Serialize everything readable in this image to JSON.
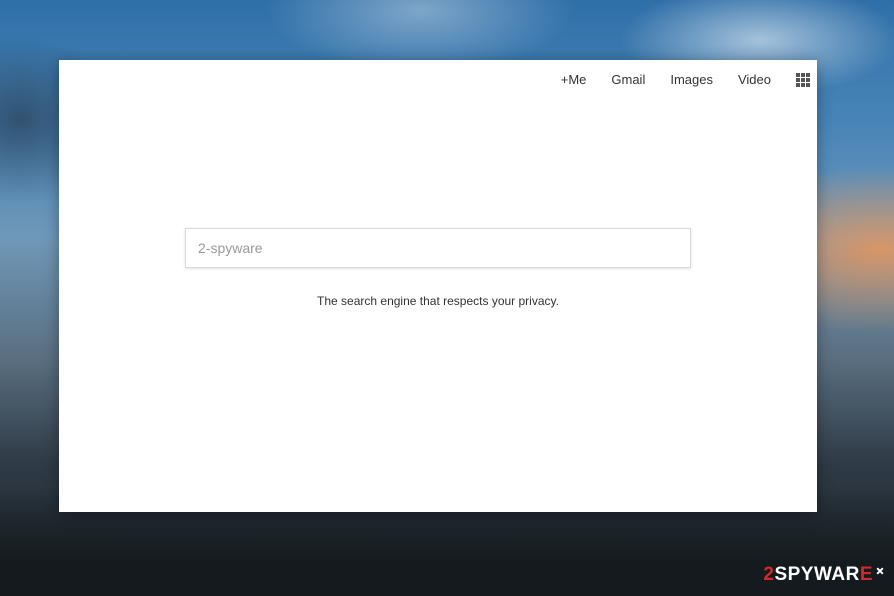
{
  "nav": {
    "items": [
      {
        "label": "+Me"
      },
      {
        "label": "Gmail"
      },
      {
        "label": "Images"
      },
      {
        "label": "Video"
      }
    ],
    "apps_icon": "grid-apps-icon"
  },
  "search": {
    "placeholder": "2-spyware",
    "value": ""
  },
  "tagline": "The search engine that respects your privacy.",
  "watermark": {
    "part1": "2",
    "part2": "SPY",
    "part3": "WAR",
    "part4": "E"
  },
  "colors": {
    "watermark_accent": "#d22a2a",
    "text": "#333333",
    "placeholder": "#9a9a9a"
  }
}
